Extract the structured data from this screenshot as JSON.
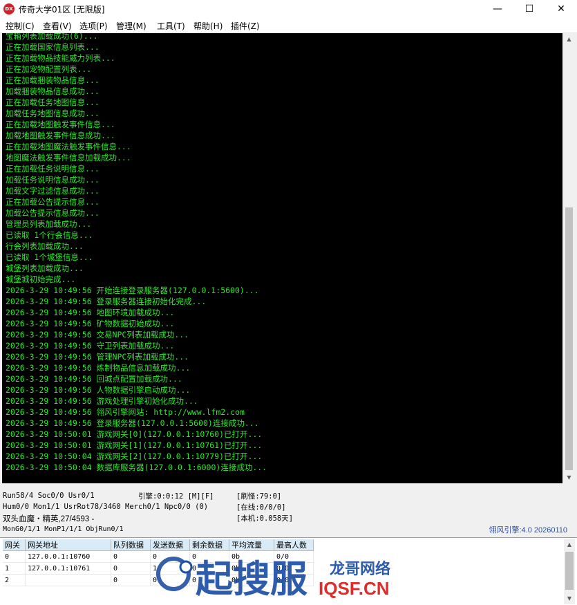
{
  "window": {
    "title": "传奇大学01区 [无限版]",
    "app_icon_text": "DX",
    "controls": {
      "minimize": "—",
      "maximize": "☐",
      "close": "✕"
    }
  },
  "menu": [
    {
      "label": "控制(C)"
    },
    {
      "label": "查看(V)"
    },
    {
      "label": "选项(P)"
    },
    {
      "label": "管理(M)"
    },
    {
      "label": "工具(T)"
    },
    {
      "label": "帮助(H)"
    },
    {
      "label": "插件(Z)"
    }
  ],
  "console_lines": [
    "宝箱列表加载成功(6)...",
    "正在加载国家信息列表...",
    "正在加载物品技能威力列表...",
    "正在加宠物配置列表...",
    "正在加载捆装物品信息...",
    "加载捆装物品信息成功...",
    "正在加载任务地图信息...",
    "加载任务地图信息成功...",
    "正在加载地图触发事件信息...",
    "加载地图触发事件信息成功...",
    "正在加载地图魔法触发事件信息...",
    "地图魔法触发事件信息加载成功...",
    "正在加载任务说明信息...",
    "加载任务说明信息成功...",
    "加载文字过滤信息成功...",
    "正在加载公告提示信息...",
    "加载公告提示信息成功...",
    "管理员列表加载成功...",
    "已读取 1个行会信息...",
    "行会列表加载成功...",
    "已读取 1个城堡信息...",
    "城堡列表加载成功...",
    "城堡城初始完成...",
    "2026-3-29 10:49:56 开始连接登录服务器(127.0.0.1:5600)...",
    "2026-3-29 10:49:56 登录服务器连接初始化完成...",
    "2026-3-29 10:49:56 地图环境加载成功...",
    "2026-3-29 10:49:56 矿物数据初始成功...",
    "2026-3-29 10:49:56 交易NPC列表加载成功...",
    "2026-3-29 10:49:56 守卫列表加载成功...",
    "2026-3-29 10:49:56 管理NPC列表加载成功...",
    "2026-3-29 10:49:56 炼制物品信息加载成功...",
    "2026-3-29 10:49:56 回城点配置加载成功...",
    "2026-3-29 10:49:56 人物数据引擎启动成功...",
    "2026-3-29 10:49:56 游戏处理引擎初始化成功...",
    "2026-3-29 10:49:56 翎风引擎网站: http://www.lfm2.com",
    "2026-3-29 10:49:56 登录服务器(127.0.0.1:5600)连接成功...",
    "2026-3-29 10:50:01 游戏网关[0](127.0.0.1:10760)已打开...",
    "2026-3-29 10:50:01 游戏网关[1](127.0.0.1:10761)已打开...",
    "2026-3-29 10:50:04 游戏网关[2](127.0.0.1:10779)已打开...",
    "2026-3-29 10:50:04 数据库服务器(127.0.0.1:6000)连接成功..."
  ],
  "status": {
    "run": "Run58/4 Soc0/0 Usr0/1",
    "engine": "引擎:0:0:12 [M][F]",
    "refresh": "[刷怪:79:0]",
    "hum": "Hum0/0 Mon1/1 UsrRot78/3460 Merch0/1 Npc0/0 (0)",
    "online": "[在线:0/0/0]",
    "boss": "双头血魔・精英,27/4593 -",
    "local": "[本机:0.058天]",
    "mon": "MonG0/1/1 MonP1/1/1 ObjRun0/1",
    "version": "翎风引擎:4.0 20260110"
  },
  "gateway_table": {
    "headers": [
      "网关",
      "网关地址",
      "队列数据",
      "发送数据",
      "剩余数据",
      "平均流量",
      "最高人数"
    ],
    "rows": [
      [
        "0",
        "127.0.0.1:10760",
        "0",
        "0",
        "0",
        "0b",
        "0/0"
      ],
      [
        "1",
        "127.0.0.1:10761",
        "0",
        "1",
        "0",
        "0b",
        "0/0"
      ],
      [
        "2",
        "",
        "0",
        "0",
        "0",
        "0b",
        "0/0"
      ]
    ]
  },
  "watermark": {
    "brand": "起搜服",
    "sub": "龙哥网络",
    "domain": "IQSF.CN"
  },
  "colors": {
    "console_bg": "#000000",
    "console_text": "#2ee82e",
    "header_bg": "#d9ebf7",
    "version_text": "#2a4ea0",
    "watermark_blue": "#1e4fa3",
    "watermark_red": "#e02020"
  }
}
